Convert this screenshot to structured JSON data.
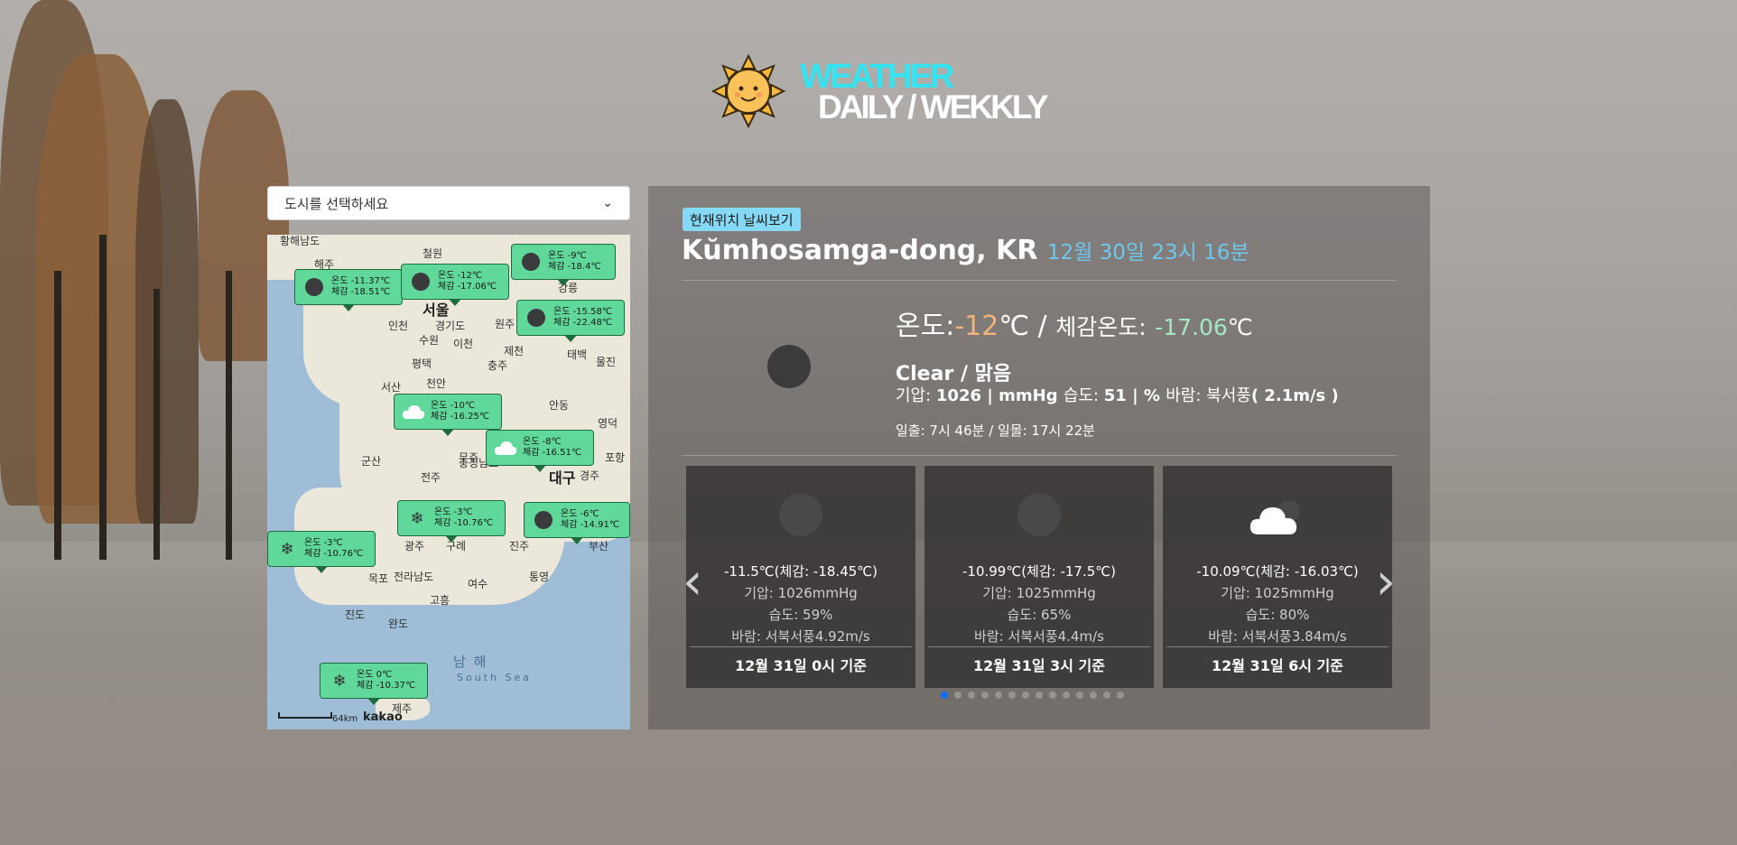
{
  "header": {
    "brand_line1": "WEATHER",
    "brand_line2": "DAILY / WEKKLY",
    "logo_icon": "sun-icon"
  },
  "city_select": {
    "placeholder": "도시를 선택하세요"
  },
  "map": {
    "labels": [
      "황해남도",
      "해주",
      "철원",
      "서울",
      "인천",
      "수원",
      "경기도",
      "원주",
      "강릉",
      "이천",
      "태백",
      "평택",
      "충주",
      "제천",
      "울진",
      "천안",
      "서산",
      "안동",
      "충청남도",
      "영덕",
      "포항",
      "대구",
      "군산",
      "경주",
      "전주",
      "무주",
      "광주",
      "구례",
      "진주",
      "부산",
      "목포",
      "여수",
      "통영",
      "전라남도",
      "진도",
      "고흥",
      "완도",
      "제주"
    ],
    "sea_name": "남 해",
    "sea_name_en": "South Sea",
    "scale_label": "64km",
    "provider": "kakao",
    "markers": [
      {
        "icon": "dot",
        "temp": "온도 -11.37℃",
        "feel": "체감 -18.51℃"
      },
      {
        "icon": "dot",
        "temp": "온도 -12℃",
        "feel": "체감 -17.06℃"
      },
      {
        "icon": "dot",
        "temp": "온도 -9℃",
        "feel": "체감 -18.4℃"
      },
      {
        "icon": "dot",
        "temp": "온도 -15.58℃",
        "feel": "체감 -22.48℃"
      },
      {
        "icon": "cloud",
        "temp": "온도 -10℃",
        "feel": "체감 -16.25℃"
      },
      {
        "icon": "cloud",
        "temp": "온도 -8℃",
        "feel": "체감 -16.51℃"
      },
      {
        "icon": "snow",
        "temp": "온도 -3℃",
        "feel": "체감 -10.76℃"
      },
      {
        "icon": "dot",
        "temp": "온도 -6℃",
        "feel": "체감 -14.91℃"
      },
      {
        "icon": "snow",
        "temp": "온도 -3℃",
        "feel": "체감 -10.76℃"
      },
      {
        "icon": "snow",
        "temp": "온도 0℃",
        "feel": "체감 -10.37℃"
      }
    ]
  },
  "current": {
    "location_button": "현재위치 날씨보기",
    "city": "Kŭmhosamga-dong, KR",
    "datetime": "12월 30일 23시 16분",
    "temp_label": "온도:",
    "temp_value": "-12",
    "temp_unit": "℃ / ",
    "feel_label": "체감온도:",
    "feel_value": "-17.06",
    "feel_unit": "℃",
    "description": "Clear / 맑음",
    "pressure_label": "기압: ",
    "pressure_value": "1026",
    "pressure_unit": " | mmHg ",
    "humidity_label": "습도: ",
    "humidity_value": "51",
    "humidity_unit": " | % ",
    "wind_label": "바람: 북서풍",
    "wind_value": "( 2.1m/s )",
    "sun": "일출: 7시 46분 / 일몰: 17시 22분"
  },
  "forecast": [
    {
      "icon": "dot",
      "temp": "-11.5℃(체감: -18.45℃)",
      "pressure": "기압: 1026mmHg",
      "humidity": "습도: 59%",
      "wind": "바람: 서북서풍4.92m/s",
      "time": "12월 31일 0시 기준"
    },
    {
      "icon": "dot",
      "temp": "-10.99℃(체감: -17.5℃)",
      "pressure": "기압: 1025mmHg",
      "humidity": "습도: 65%",
      "wind": "바람: 서북서풍4.4m/s",
      "time": "12월 31일 3시 기준"
    },
    {
      "icon": "cloud",
      "temp": "-10.09℃(체감: -16.03℃)",
      "pressure": "기압: 1025mmHg",
      "humidity": "습도: 80%",
      "wind": "바람: 서북서풍3.84m/s",
      "time": "12월 31일 6시 기준"
    }
  ],
  "carousel": {
    "prev_icon": "chevron-left-icon",
    "next_icon": "chevron-right-icon",
    "page_count": 14,
    "active_page": 1
  },
  "colors": {
    "brand_cyan": "#36e3f0",
    "temp_accent": "#f0b27a",
    "feel_accent": "#a7e8c4",
    "date_accent": "#6fc7ee",
    "marker_green": "#5fd89a",
    "button_blue": "#86d9f5"
  }
}
